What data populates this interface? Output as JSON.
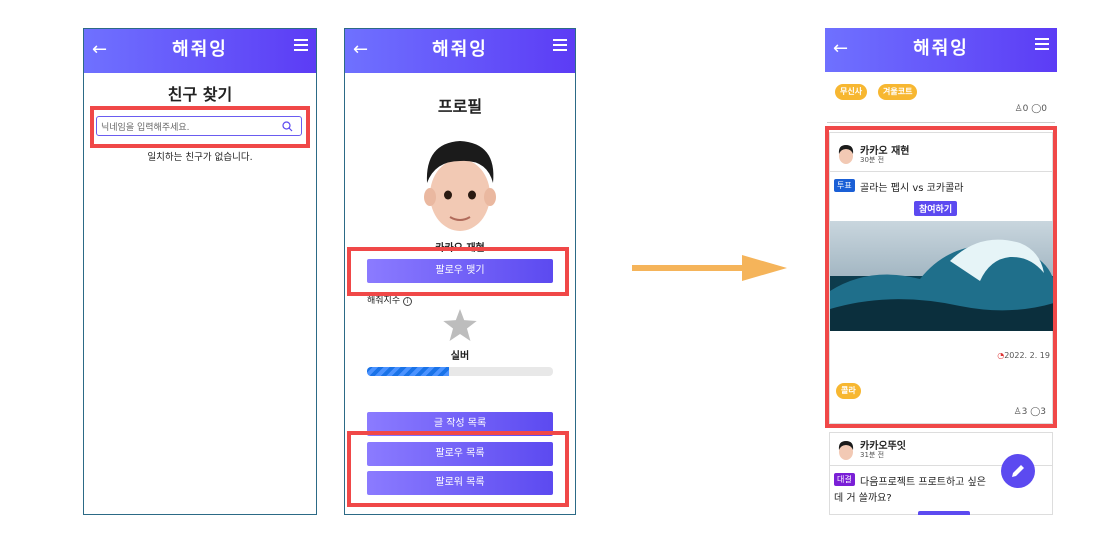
{
  "app": {
    "logo": "해줘잉",
    "back": "←"
  },
  "phone1": {
    "title": "친구 찾기",
    "search_placeholder": "닉네임을 입력해주세요.",
    "empty_text": "일치하는 친구가 없습니다."
  },
  "phone2": {
    "title": "프로필",
    "name": "카카오 재현",
    "follow_button": "팔로우 맺기",
    "stat_label": "해줘지수",
    "tier": "실버",
    "progress": 0.44,
    "posts_button": "글 작성 목록",
    "following_button": "팔로우 목록",
    "followers_button": "팔로워 목록"
  },
  "phone3": {
    "top_tags": [
      "무신사",
      "겨울코트"
    ],
    "top_likes": "0",
    "top_comments": "0",
    "post1": {
      "author": "카카오 재현",
      "time": "30분 전",
      "badge": "투표",
      "text": "골라는 펩시 vs 코카콜라",
      "vote_button": "참여하기",
      "date": "2022. 2. 19",
      "tag": "콜라",
      "likes": "3",
      "comments": "3"
    },
    "post2": {
      "author": "카카오뚜잇",
      "time": "31분 전",
      "badge": "대결",
      "text_line1": "다음프로젝트 프로트하고 싶은",
      "text_line2": "데 거 쓸까요?"
    }
  },
  "colors": {
    "header": "#5c3cf5",
    "highlight": "#f04848",
    "tag": "#f7b731",
    "arrow": "#f5b45a"
  }
}
